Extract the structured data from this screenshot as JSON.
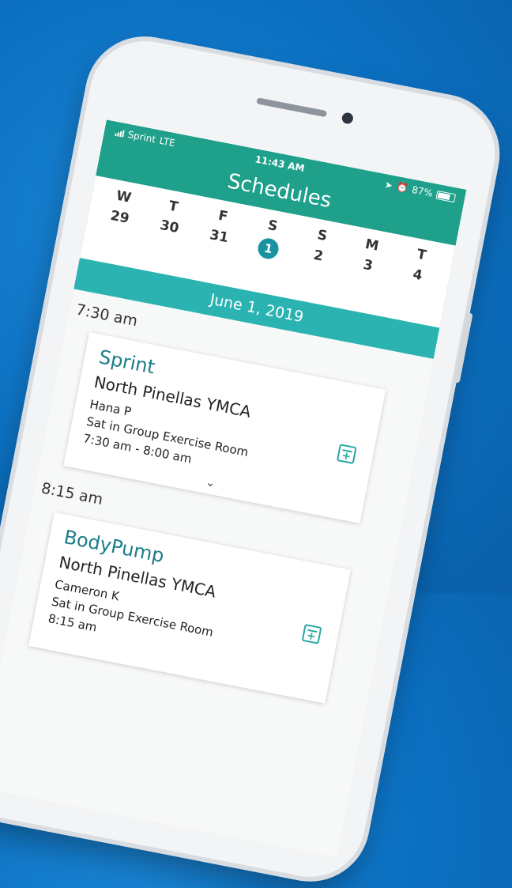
{
  "status_bar": {
    "carrier": "Sprint",
    "network": "LTE",
    "time": "11:43 AM",
    "battery": "87%"
  },
  "header": {
    "title": "Schedules"
  },
  "week": [
    {
      "dow": "W",
      "date": "29"
    },
    {
      "dow": "T",
      "date": "30"
    },
    {
      "dow": "F",
      "date": "31"
    },
    {
      "dow": "S",
      "date": "1",
      "selected": true
    },
    {
      "dow": "S",
      "date": "2"
    },
    {
      "dow": "M",
      "date": "3"
    },
    {
      "dow": "T",
      "date": "4"
    }
  ],
  "selected_date": "June 1, 2019",
  "schedule": [
    {
      "time": "7:30 am",
      "class": "Sprint",
      "location": "North Pinellas YMCA",
      "instructor": "Hana P",
      "room": "Sat in Group Exercise Room",
      "hours": "7:30 am - 8:00 am"
    },
    {
      "time": "8:15 am",
      "class": "BodyPump",
      "location": "North Pinellas YMCA",
      "instructor": "Cameron K",
      "room": "Sat in Group Exercise Room",
      "hours": "8:15 am"
    }
  ],
  "colors": {
    "header": "#1fa08a",
    "band": "#2ab3b0",
    "accent": "#1a93a0",
    "background": "#0b6fc0"
  },
  "icons": {
    "add_to_calendar": "calendar-plus-icon",
    "expand": "chevron-down-icon"
  }
}
